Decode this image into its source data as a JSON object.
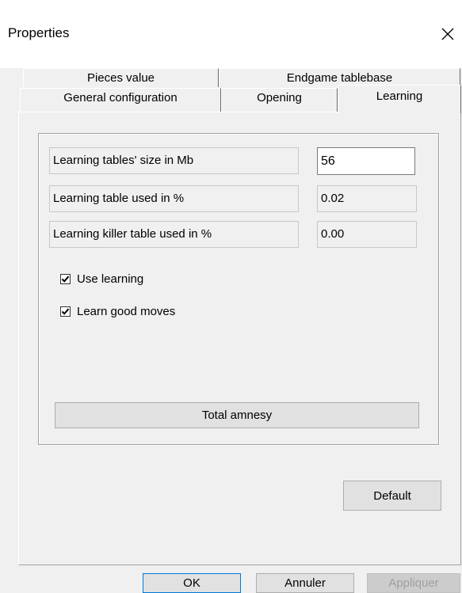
{
  "window": {
    "title": "Properties",
    "close_glyph": "✕"
  },
  "tabs": {
    "row1": [
      {
        "label": "Pieces value"
      },
      {
        "label": "Endgame tablebase"
      }
    ],
    "row2": [
      {
        "label": "General configuration"
      },
      {
        "label": "Opening"
      },
      {
        "label": "Learning",
        "active": true
      }
    ]
  },
  "learning": {
    "fields": [
      {
        "label": "Learning tables' size in Mb",
        "value": "56",
        "editable": true
      },
      {
        "label": "Learning table used in %",
        "value": "0.02",
        "editable": false
      },
      {
        "label": "Learning killer table used in %",
        "value": "0.00",
        "editable": false
      }
    ],
    "checkboxes": [
      {
        "label": "Use learning",
        "checked": true
      },
      {
        "label": "Learn good moves",
        "checked": true
      }
    ],
    "amnesia_button": "Total amnesy",
    "default_button": "Default"
  },
  "footer": {
    "ok": "OK",
    "cancel": "Annuler",
    "apply": "Appliquer"
  },
  "colors": {
    "window_bg": "#f0f0f0",
    "focus_border": "#0078d7",
    "disabled_text": "#a0a0a0"
  }
}
